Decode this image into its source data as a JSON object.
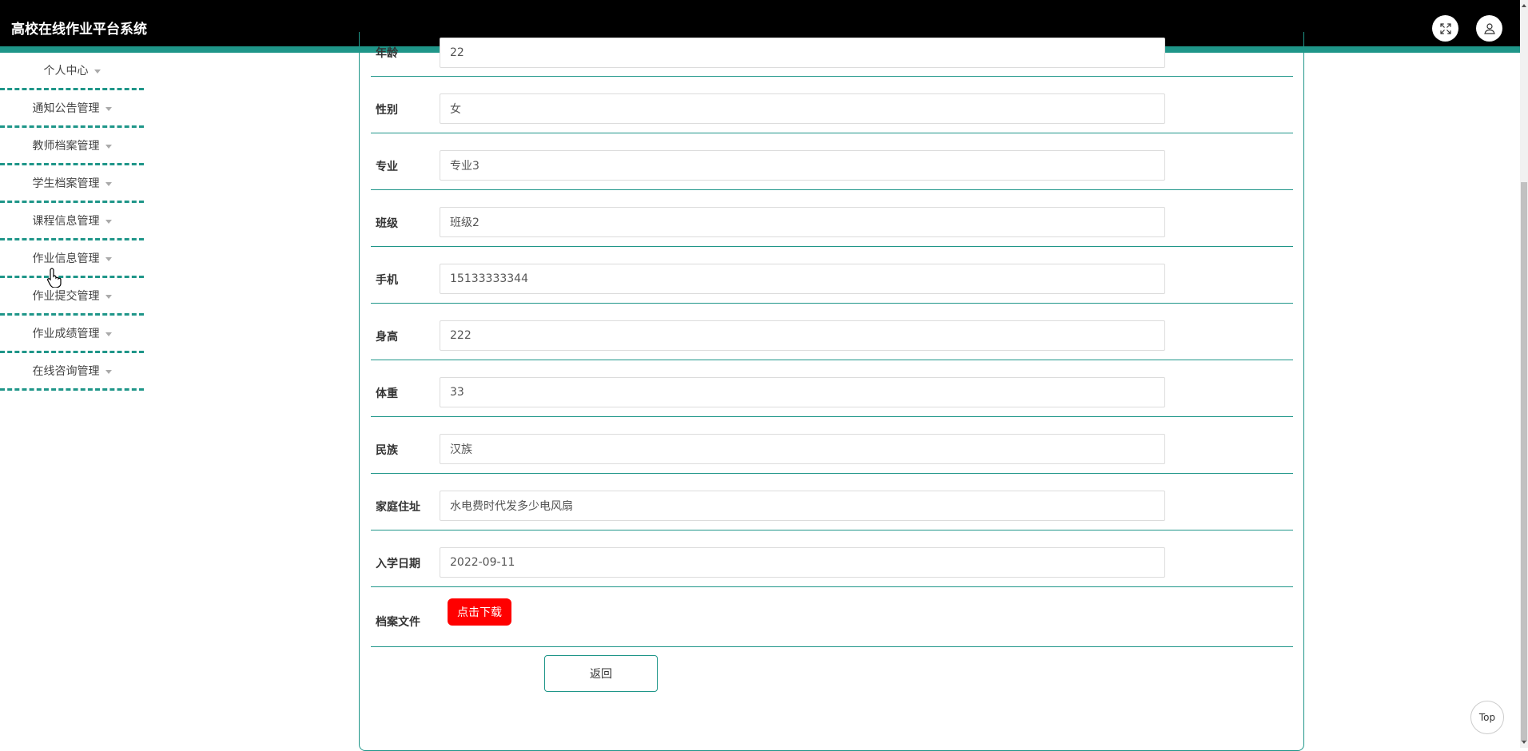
{
  "header": {
    "title": "高校在线作业平台系统",
    "fullscreen_icon": "fullscreen-icon",
    "user_icon": "user-icon"
  },
  "sidebar": {
    "items": [
      {
        "label": "个人中心"
      },
      {
        "label": "通知公告管理"
      },
      {
        "label": "教师档案管理"
      },
      {
        "label": "学生档案管理"
      },
      {
        "label": "课程信息管理"
      },
      {
        "label": "作业信息管理"
      },
      {
        "label": "作业提交管理"
      },
      {
        "label": "作业成绩管理"
      },
      {
        "label": "在线咨询管理"
      }
    ]
  },
  "form": {
    "fields": [
      {
        "label": "年龄",
        "value": "22"
      },
      {
        "label": "性别",
        "value": "女"
      },
      {
        "label": "专业",
        "value": "专业3"
      },
      {
        "label": "班级",
        "value": "班级2"
      },
      {
        "label": "手机",
        "value": "15133333344"
      },
      {
        "label": "身高",
        "value": "222"
      },
      {
        "label": "体重",
        "value": "33"
      },
      {
        "label": "民族",
        "value": "汉族"
      },
      {
        "label": "家庭住址",
        "value": "水电费时代发多少电风扇"
      },
      {
        "label": "入学日期",
        "value": "2022-09-11"
      }
    ],
    "file_label": "档案文件",
    "download_label": "点击下载",
    "back_label": "返回"
  },
  "top_button": "Top",
  "colors": {
    "accent": "#1f9689",
    "header_bg": "#000000",
    "download_bg": "#ff0000"
  }
}
